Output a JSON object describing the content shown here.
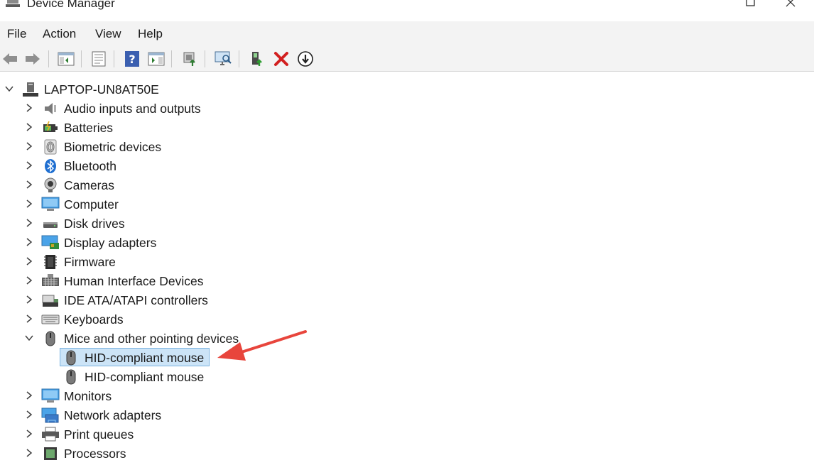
{
  "window": {
    "title": "Device Manager"
  },
  "menu": [
    "File",
    "Action",
    "View",
    "Help"
  ],
  "toolbar": {
    "buttons": [
      {
        "icon": "back-arrow-icon"
      },
      {
        "icon": "forward-arrow-icon"
      },
      {
        "icon": "show-hide-console-tree-icon"
      },
      {
        "icon": "properties-icon"
      },
      {
        "icon": "help-icon"
      },
      {
        "icon": "show-action-pane-icon"
      },
      {
        "icon": "update-driver-icon"
      },
      {
        "icon": "scan-hardware-icon"
      },
      {
        "icon": "enable-device-icon"
      },
      {
        "icon": "uninstall-device-icon"
      },
      {
        "icon": "disable-device-icon"
      }
    ]
  },
  "tree": {
    "root": {
      "label": "LAPTOP-UN8AT50E",
      "icon": "computer-tower-icon"
    },
    "categories": [
      {
        "label": "Audio inputs and outputs",
        "icon": "speaker-icon",
        "expanded": false
      },
      {
        "label": "Batteries",
        "icon": "battery-icon",
        "expanded": false
      },
      {
        "label": "Biometric devices",
        "icon": "fingerprint-icon",
        "expanded": false
      },
      {
        "label": "Bluetooth",
        "icon": "bluetooth-icon",
        "expanded": false
      },
      {
        "label": "Cameras",
        "icon": "webcam-icon",
        "expanded": false
      },
      {
        "label": "Computer",
        "icon": "monitor-icon",
        "expanded": false
      },
      {
        "label": "Disk drives",
        "icon": "disk-drive-icon",
        "expanded": false
      },
      {
        "label": "Display adapters",
        "icon": "display-adapter-icon",
        "expanded": false
      },
      {
        "label": "Firmware",
        "icon": "chip-icon",
        "expanded": false
      },
      {
        "label": "Human Interface Devices",
        "icon": "hid-keyboard-icon",
        "expanded": false
      },
      {
        "label": "IDE ATA/ATAPI controllers",
        "icon": "ide-controller-icon",
        "expanded": false
      },
      {
        "label": "Keyboards",
        "icon": "keyboard-icon",
        "expanded": false
      },
      {
        "label": "Mice and other pointing devices",
        "icon": "mouse-icon",
        "expanded": true,
        "children": [
          {
            "label": "HID-compliant mouse",
            "icon": "mouse-icon",
            "selected": true
          },
          {
            "label": "HID-compliant mouse",
            "icon": "mouse-icon",
            "selected": false
          }
        ]
      },
      {
        "label": "Monitors",
        "icon": "monitor-icon",
        "expanded": false
      },
      {
        "label": "Network adapters",
        "icon": "network-adapter-icon",
        "expanded": false
      },
      {
        "label": "Print queues",
        "icon": "printer-icon",
        "expanded": false
      },
      {
        "label": "Processors",
        "icon": "processor-icon",
        "expanded": false
      }
    ]
  },
  "colors": {
    "selection_bg": "#cce4f7",
    "selection_border": "#7bb3e0",
    "annotation_arrow": "#e8453c",
    "menubar_bg": "#f3f3f3"
  }
}
